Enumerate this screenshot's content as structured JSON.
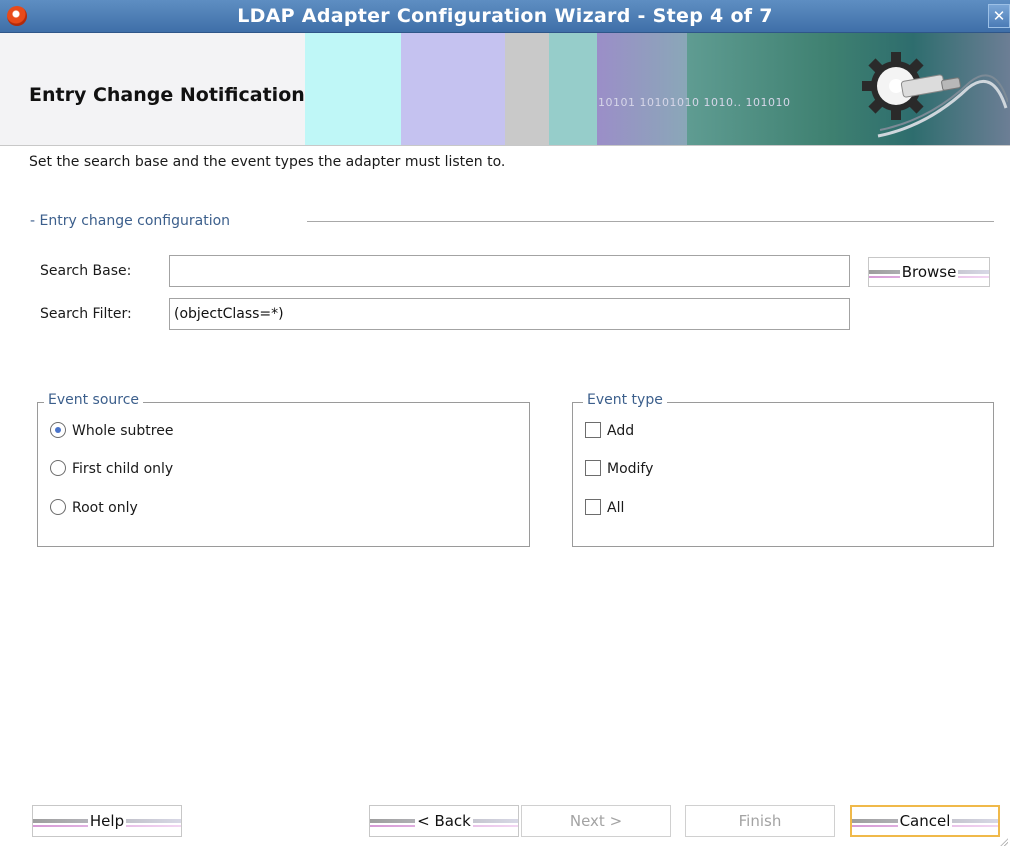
{
  "window": {
    "title": "LDAP Adapter Configuration Wizard - Step 4 of 7",
    "close_glyph": "✕",
    "app_icon": "oracle-logo-icon"
  },
  "header": {
    "title": "Entry Change Notification",
    "binary_text": "10101 10101010 1010..  101010",
    "logo_icon": "gear-plug-icon"
  },
  "intro_text": "Set the search base and the event types the adapter must listen to.",
  "entry_config": {
    "section_label": "- Entry change configuration",
    "search_base_label": "Search Base:",
    "search_base_value": "",
    "search_filter_label": "Search Filter:",
    "search_filter_value": "(objectClass=*)",
    "browse_label": "Browse"
  },
  "event_source": {
    "legend": "Event source",
    "options": [
      {
        "label": "Whole subtree",
        "selected": true
      },
      {
        "label": "First child only",
        "selected": false
      },
      {
        "label": "Root only",
        "selected": false
      }
    ]
  },
  "event_type": {
    "legend": "Event type",
    "options": [
      {
        "label": "Add",
        "checked": false
      },
      {
        "label": "Modify",
        "checked": false
      },
      {
        "label": "All",
        "checked": false
      }
    ]
  },
  "footer": {
    "help": "Help",
    "back": "< Back",
    "next": "Next >",
    "finish": "Finish",
    "cancel": "Cancel"
  },
  "colors": {
    "titlebar": "#4a7ab4",
    "section_text": "#3c5f8c",
    "default_button_border": "#f0b94a",
    "radio_selected": "#4a74c9"
  }
}
